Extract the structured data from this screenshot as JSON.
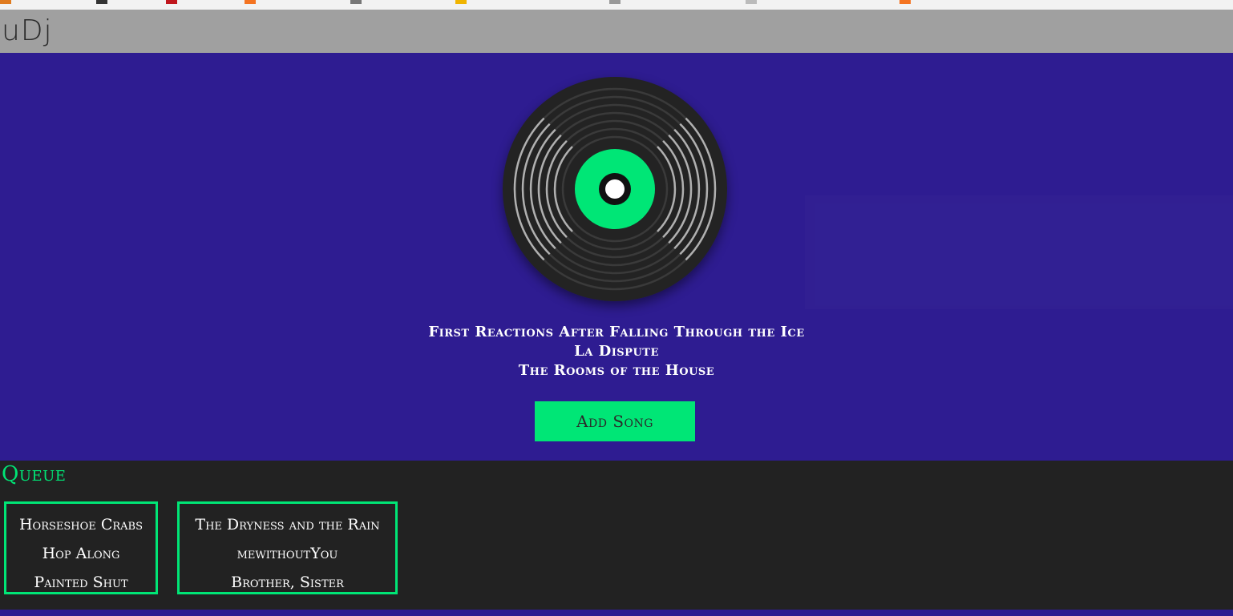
{
  "app": {
    "title": "uDj"
  },
  "now_playing": {
    "song": "First Reactions After Falling Through the Ice",
    "artist": "La Dispute",
    "album": "The Rooms of the House"
  },
  "actions": {
    "add_song_label": "Add Song"
  },
  "queue": {
    "title": "Queue",
    "items": [
      {
        "song": "Horseshoe Crabs",
        "artist": "Hop Along",
        "album": "Painted Shut"
      },
      {
        "song": "The Dryness and the Rain",
        "artist": "mewithoutYou",
        "album": "Brother, Sister"
      }
    ]
  },
  "colors": {
    "background": "#2e1c91",
    "header": "#a0a0a0",
    "accent": "#00e676",
    "queue_background": "#222222",
    "record": "#232323"
  },
  "icons": {
    "record": "vinyl-record-icon"
  }
}
